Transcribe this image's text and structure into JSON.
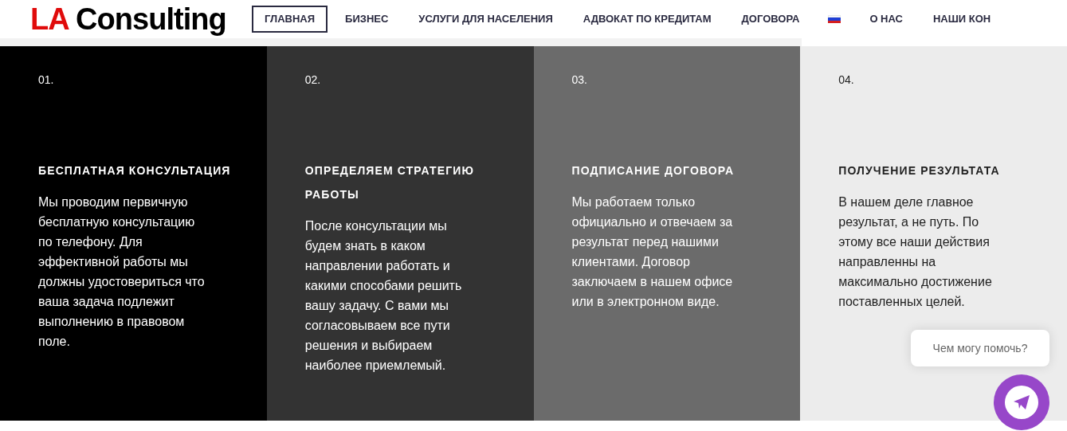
{
  "header": {
    "logo_accent": "LA",
    "logo_text": "Consulting",
    "nav": [
      {
        "label": "ГЛАВНАЯ",
        "selected": true
      },
      {
        "label": "БИЗНЕС",
        "selected": false
      },
      {
        "label": "УСЛУГИ ДЛЯ НАСЕЛЕНИЯ",
        "selected": false
      },
      {
        "label": "АДВОКАТ ПО КРЕДИТАМ",
        "selected": false
      },
      {
        "label": "ДОГОВОРА",
        "selected": false
      },
      {
        "kind": "flag",
        "selected": false
      },
      {
        "label": "О НАС",
        "selected": false
      },
      {
        "label": "НАШИ КОН",
        "selected": false
      }
    ]
  },
  "steps": [
    {
      "number": "01.",
      "title": "БЕСПЛАТНАЯ КОНСУЛЬТАЦИЯ",
      "text": "Мы проводим первичную бесплатную консультацию по телефону. Для эффективной работы мы должны удостовериться что ваша задача подлежит выполнению в правовом поле.",
      "color": "#000000"
    },
    {
      "number": "02.",
      "title": "ОПРЕДЕЛЯЕМ СТРАТЕГИЮ РАБОТЫ",
      "text": "После консультации мы будем знать в каком направлении работать и какими способами решить вашу задачу. С вами мы согласовываем все пути решения и выбираем наиболее приемлемый.",
      "color": "#333333"
    },
    {
      "number": "03.",
      "title": "ПОДПИСАНИЕ ДОГОВОРА",
      "text": "Мы работаем только официально и отвечаем за результат перед нашими клиентами. Договор заключаем в нашем офисе или в электронном виде.",
      "color": "#6b6b6b"
    },
    {
      "number": "04.",
      "title": "ПОЛУЧЕНИЕ РЕЗУЛЬТАТА",
      "text": "В нашем деле главное результат, а не путь. По этому все наши действия направленны на максимально достижение поставленных  целей.",
      "color": "#ececec"
    }
  ],
  "chat": {
    "prompt": "Чем могу помочь?"
  }
}
